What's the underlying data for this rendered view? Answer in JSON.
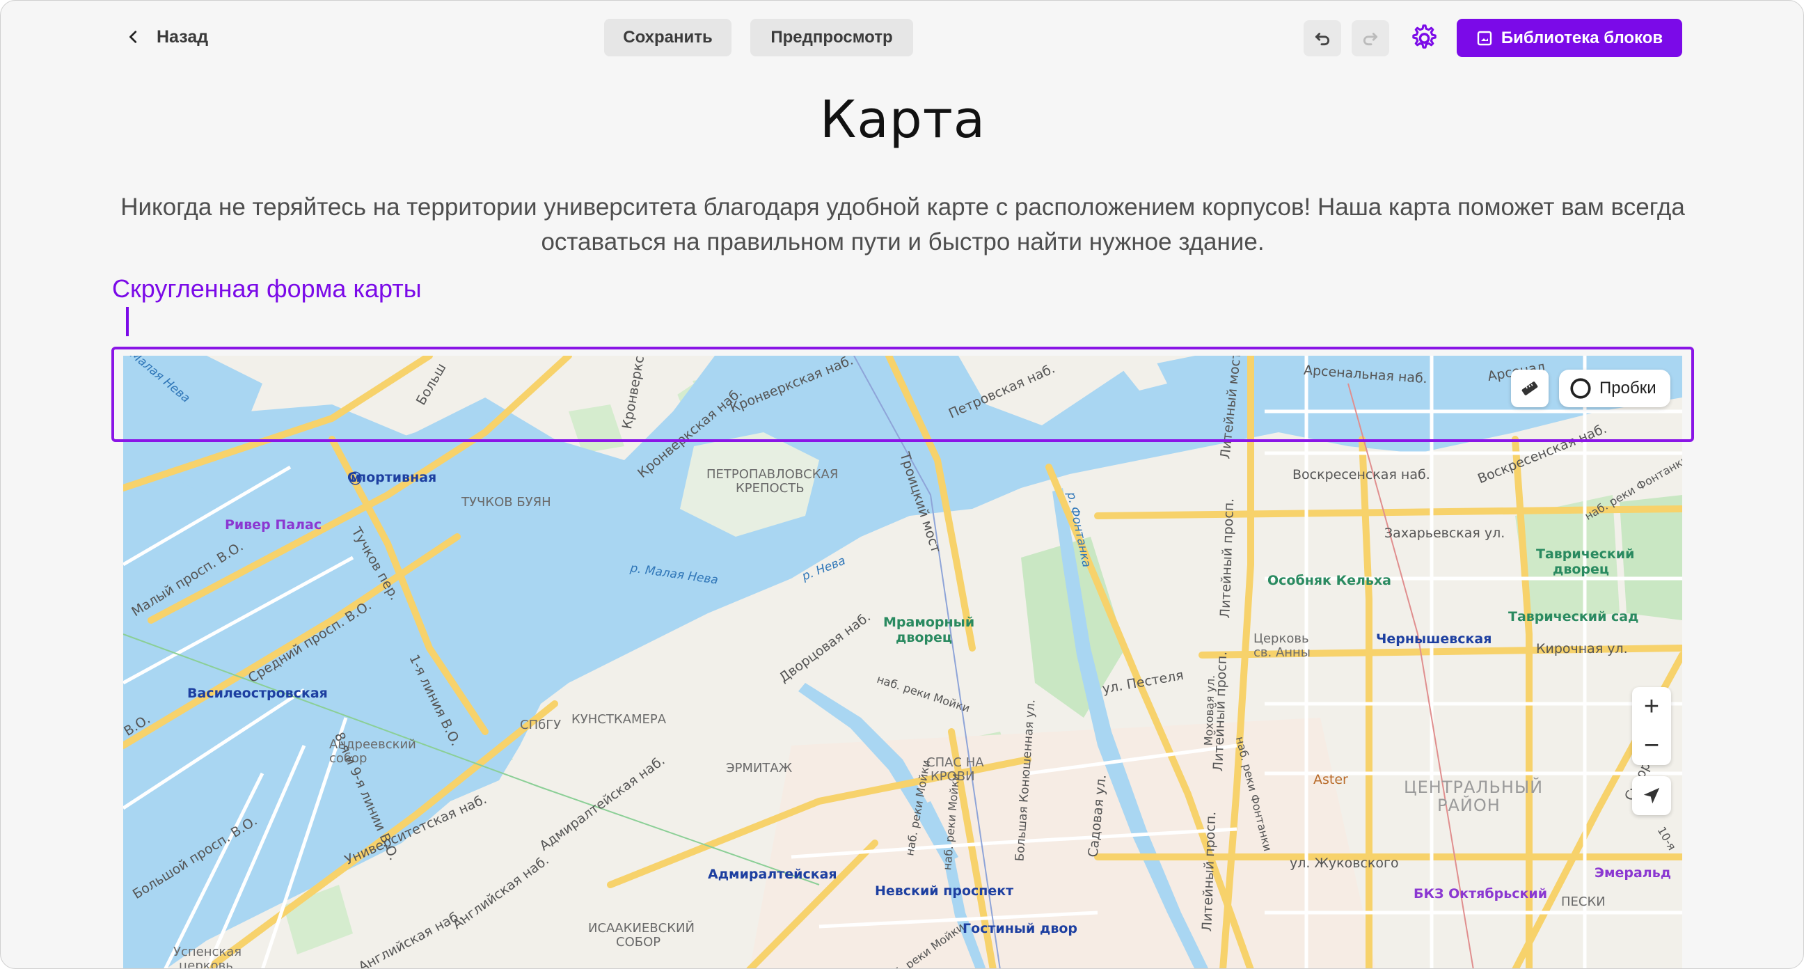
{
  "header": {
    "back_label": "Назад",
    "save_label": "Сохранить",
    "preview_label": "Предпросмотр",
    "library_label": "Библиотека блоков"
  },
  "page": {
    "title": "Карта",
    "description": "Никогда не теряйтесь на территории университета благодаря удобной карте с расположением корпусов! Наша карта поможет вам всегда оставаться на правильном пути и быстро найти нужное здание.",
    "annotation": "Скругленная форма карты"
  },
  "map": {
    "traffic_label": "Пробки",
    "zoom_in": "+",
    "zoom_out": "−",
    "labels": {
      "m_sportivnaya": "Спортивная",
      "m_vasileostrovskaya": "Василеостровская",
      "m_admiralteyskaya": "Адмиралтейская",
      "m_nevsky": "Невский проспект",
      "m_gostiny": "Гостиный двор",
      "m_chernyshevskaya": "Чернышевская",
      "river_palace": "Ривер Палас",
      "petropavlovskaya1": "ПЕТРОПАВЛОВСКАЯ",
      "petropavlovskaya2": "КРЕПОСТЬ",
      "tuchkov": "ТУЧКОВ БУЯН",
      "spbgu": "СПбГУ",
      "kunstkamera": "КУНСТКАМЕРА",
      "ermitazh": "ЭРМИТАЖ",
      "spas1": "СПАС НА",
      "spas2": "КРОВИ",
      "isaakiy1": "ИСААКИЕВСКИЙ",
      "isaakiy2": "СОБОР",
      "mramorny1": "Мраморный",
      "mramorny2": "дворец",
      "kelh": "Особняк Кельха",
      "tavr_dvorec1": "Таврический",
      "tavr_dvorec2": "дворец",
      "tavr_sad": "Таврический сад",
      "church_anna1": "Церковь",
      "church_anna2": "св. Анны",
      "andreev1": "Андреевский",
      "andreev2": "собор",
      "uspenskaya1": "Успенская",
      "uspenskaya2": "церковь",
      "aster": "Aster",
      "central1": "ЦЕНТРАЛЬНЫЙ",
      "central2": "РАЙОН",
      "bkz": "БКЗ Октябрьский",
      "emerald": "Эмеральд",
      "peski": "ПЕСКИ",
      "malaya_neva": "р. Малая Нева",
      "neva": "р. Нева",
      "fontanka": "р. Фонтанка",
      "arsenalnaya": "Арсенальная наб.",
      "arsenalnaya2": "Арсенал",
      "voskresenskaya": "Воскресенская наб.",
      "voskresenskaya2": "Воскресенская наб.",
      "kronverkskaya": "Кронверкская наб.",
      "kronverkskaya2": "Кронверкская наб.",
      "kronverksky": "Кронверкски",
      "petrovskaya": "Петровская наб.",
      "troitsky": "Троицкий мост",
      "liteyny": "Литейный мост",
      "liteyny_pr": "Литейный просп.",
      "liteyny_pr2": "Литейный просп.",
      "liteyny_pr3": "Литейный просп.",
      "zakharyevskaya": "Захарьевская ул.",
      "kirochnaya": "Кирочная ул.",
      "pestelya": "ул. Пестеля",
      "zhukovskogo": "ул. Жуковского",
      "sadovaya": "Садовая ул.",
      "mokhovaya": "Моховая ул.",
      "dvortsovaya": "Дворцовая наб.",
      "admiralteyskaya_nab": "Адмиралтейская наб.",
      "angliyskaya": "Английская наб.",
      "angliyskaya2": "Английская наб.",
      "universitetskaya": "Университетская наб.",
      "moyka": "наб. реки Мойки",
      "moyka2": "наб. реки Мойки",
      "moyka3": "наб. реки Мойки",
      "moyka4": "наб. реки Мойки",
      "konyushennaya": "Большая Конюшенная ул.",
      "fontanka_nab": "наб. реки Фонтанки",
      "fontanka_nab2": "наб. реки Фонтанки",
      "maly_vo": "Малый просп. В.О.",
      "sredny_vo": "Средний просп. В.О.",
      "bolshoy_vo": "Большой просп. В.О.",
      "line1": "1-я линия В.О.",
      "line89": "8-я и 9-я линии В.О.",
      "tuchkov_per": "Тучков пер.",
      "bolshoy_top": "Больш",
      "malaya_neva_top": "Малая Нева",
      "suvorovsky": "Суворов",
      "line10": "10-я",
      "vo_left": "В.О."
    }
  }
}
